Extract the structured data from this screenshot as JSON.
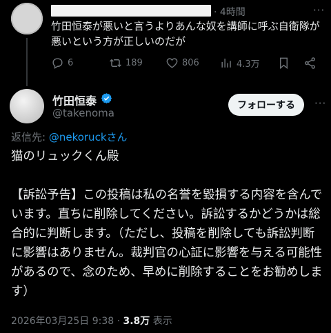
{
  "reply_tweet": {
    "time": "· 4時間",
    "text": "竹田恒泰が悪いと言うよりあんな奴を講師に呼ぶ自衛隊が悪いという方が正しいのだが",
    "more": "···",
    "stats": {
      "replies": "6",
      "retweets": "189",
      "likes": "806",
      "views": "4.3万"
    }
  },
  "main_tweet": {
    "author_name": "竹田恒泰",
    "handle": "@takenoma",
    "follow_label": "フォローする",
    "more": "···",
    "reply_to_prefix": "返信先: ",
    "reply_to_mention": "@nekoruckさん",
    "body": "猫のリュックくん殿\n\n【訴訟予告】この投稿は私の名誉を毀損する内容を含んでいます。直ちに削除してください。訴訟するかどうかは総合的に判断します。（ただし、投稿を削除しても訴訟判断に影響はありません。裁判官の心証に影響を与える可能性があるので、念のため、早めに削除することをお勧めします）",
    "date": "2026年03月25日 9:38 · ",
    "views_count": "3.8万",
    "views_label": " 表示"
  },
  "icons": {
    "reply": "reply-icon",
    "retweet": "retweet-icon",
    "like": "heart-icon",
    "views": "views-icon",
    "bookmark": "bookmark-icon",
    "share": "share-icon",
    "verified": "verified-badge-icon"
  },
  "colors": {
    "accent": "#1d9bf0",
    "muted": "#71767b",
    "text": "#e7e9ea",
    "background": "#000000"
  }
}
